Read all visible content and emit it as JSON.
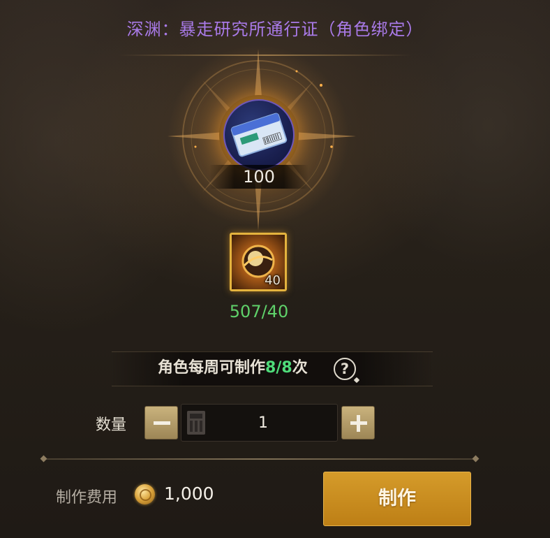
{
  "header": {
    "title": "深渊：暴走研究所通行证（角色绑定）",
    "title_color": "#a97ae8"
  },
  "product": {
    "icon": "pass-ticket-icon",
    "quantity": "100"
  },
  "material": {
    "icon": "golden-orb-icon",
    "required": "40",
    "progress": "507/40",
    "progress_color": "#5fd16a"
  },
  "weekly_limit": {
    "prefix": "角色每周可制作",
    "current": "8",
    "separator": "/",
    "max": "8",
    "suffix": "次",
    "count_color": "#4fdc7a",
    "help_icon": "question-magnifier-icon",
    "help_glyph": "?"
  },
  "quantity": {
    "label": "数量",
    "value": "1",
    "decrease_icon": "minus-icon",
    "increase_icon": "plus-icon",
    "calculator_icon": "calculator-icon"
  },
  "cost": {
    "label": "制作费用",
    "currency_icon": "gold-coin-icon",
    "value": "1,000"
  },
  "actions": {
    "craft_label": "制作"
  }
}
